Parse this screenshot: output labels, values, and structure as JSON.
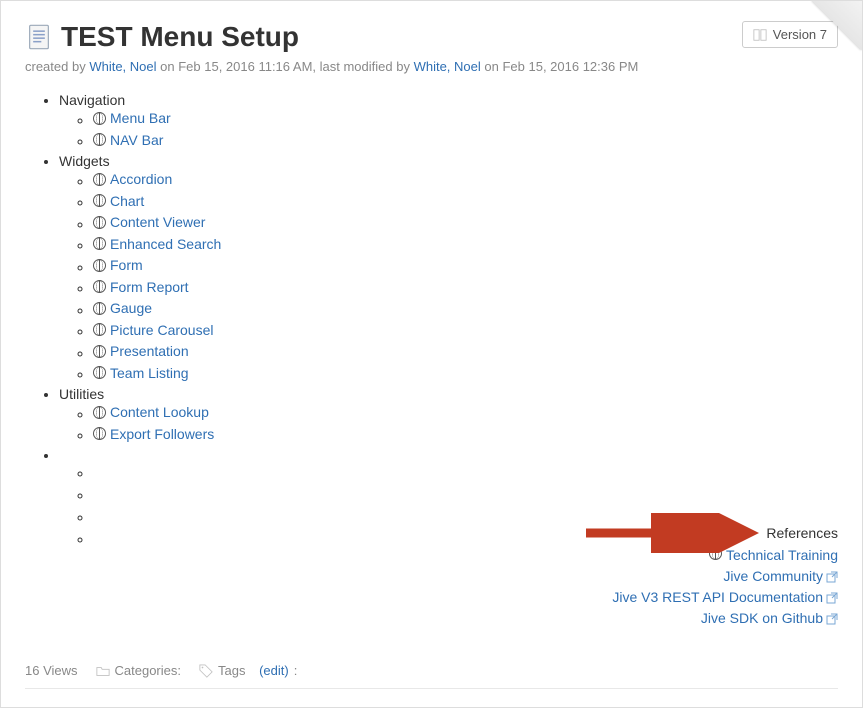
{
  "header": {
    "title": "TEST Menu Setup",
    "version_label": "Version 7"
  },
  "meta": {
    "created_prefix": "created by ",
    "created_user": "White, Noel",
    "created_suffix": " on Feb 15, 2016 11:16 AM, ",
    "modified_prefix": "last modified by ",
    "modified_user": "White, Noel",
    "modified_suffix": " on Feb 15, 2016 12:36 PM"
  },
  "sections": [
    {
      "label": "Navigation",
      "items": [
        {
          "label": "Menu Bar",
          "external": false
        },
        {
          "label": "NAV Bar",
          "external": false
        }
      ]
    },
    {
      "label": "Widgets",
      "items": [
        {
          "label": "Accordion",
          "external": false
        },
        {
          "label": "Chart",
          "external": false
        },
        {
          "label": "Content Viewer",
          "external": false
        },
        {
          "label": "Enhanced Search",
          "external": false
        },
        {
          "label": "Form",
          "external": false
        },
        {
          "label": "Form Report",
          "external": false
        },
        {
          "label": "Gauge",
          "external": false
        },
        {
          "label": "Picture Carousel",
          "external": false
        },
        {
          "label": "Presentation",
          "external": false
        },
        {
          "label": "Team Listing",
          "external": false
        }
      ]
    },
    {
      "label": "Utilities",
      "items": [
        {
          "label": "Content Lookup",
          "external": false
        },
        {
          "label": "Export Followers",
          "external": false
        }
      ]
    }
  ],
  "references": {
    "title": "References",
    "items": [
      {
        "label": "Technical Training",
        "external": false,
        "globe": true
      },
      {
        "label": "Jive Community",
        "external": true,
        "globe": false
      },
      {
        "label": "Jive V3 REST API Documentation",
        "external": true,
        "globe": false
      },
      {
        "label": "Jive SDK on Github",
        "external": true,
        "globe": false
      }
    ]
  },
  "footer": {
    "views": "16 Views",
    "categories_label": "Categories:",
    "tags_label": "Tags",
    "edit_label": "(edit)",
    "edit_suffix": ":"
  }
}
